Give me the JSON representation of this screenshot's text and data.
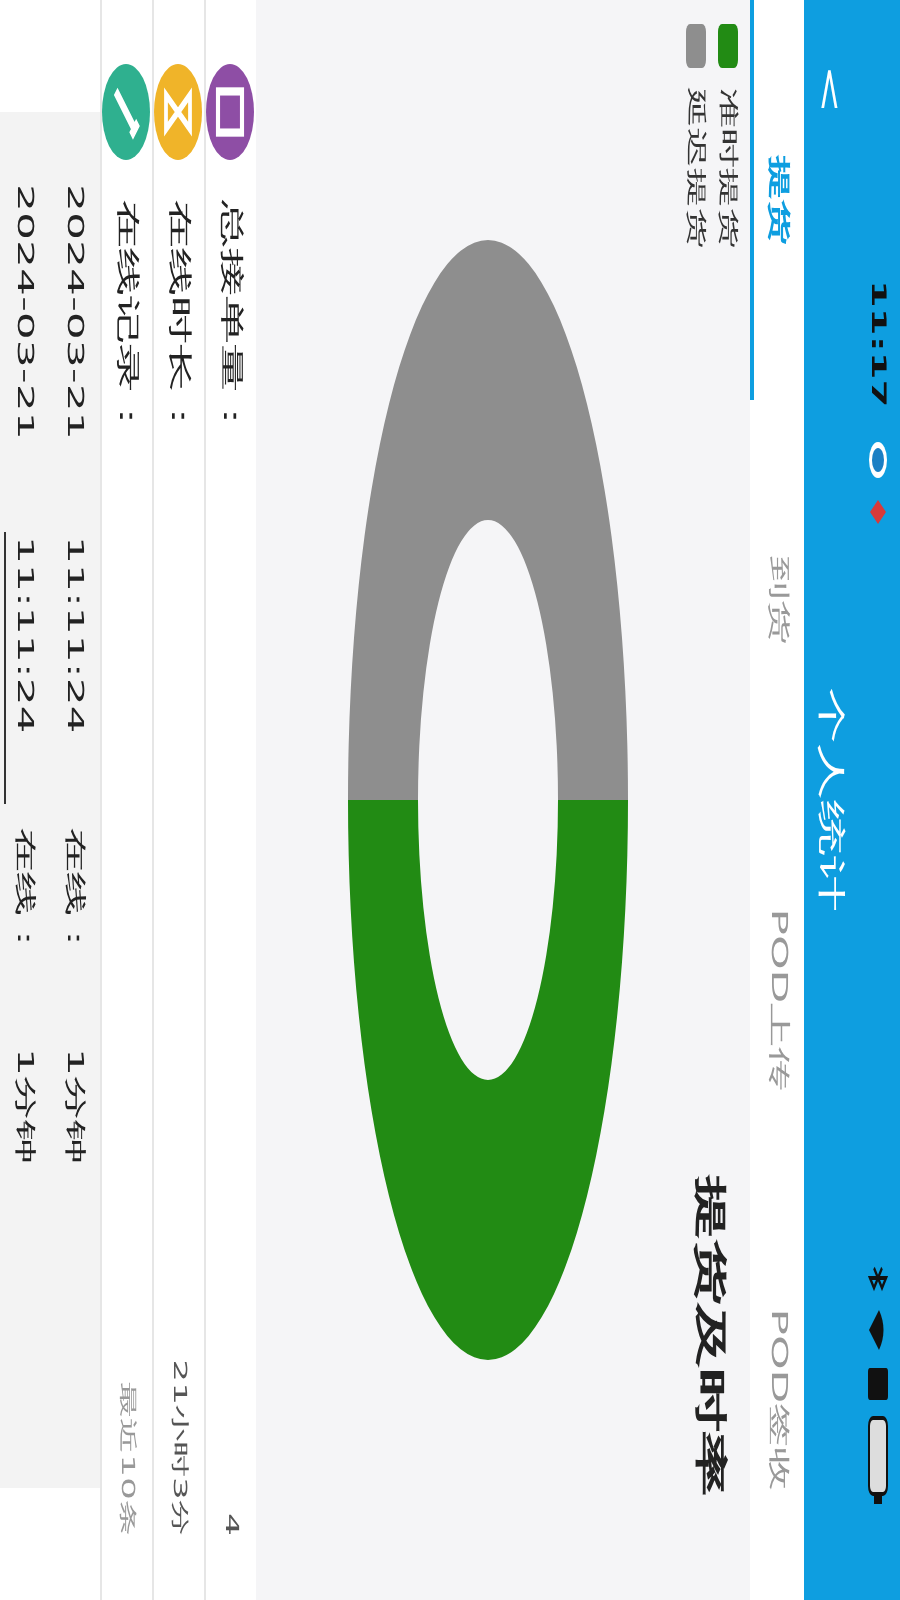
{
  "status_bar": {
    "time": "11:17"
  },
  "header": {
    "back": "<",
    "title": "个人统计"
  },
  "tabs": [
    {
      "label": "提货",
      "selected": true
    },
    {
      "label": "到货",
      "selected": false
    },
    {
      "label": "POD上传",
      "selected": false
    },
    {
      "label": "POD签收",
      "selected": false
    }
  ],
  "chart": {
    "title": "提货及时率",
    "legend": [
      {
        "label": "准时提货",
        "color": "#228b14"
      },
      {
        "label": "延迟提货",
        "color": "#8e8e8e"
      }
    ]
  },
  "stats": [
    {
      "kind": "orders",
      "label": "总接单量：",
      "value": "4"
    },
    {
      "kind": "duration",
      "label": "在线时长：",
      "value": "21小时3分"
    },
    {
      "kind": "records",
      "label": "在线记录：",
      "value": "最近10条"
    }
  ],
  "records": [
    {
      "date": "2024-03-21",
      "time": "11:11:24",
      "status": "在线：",
      "duration": "1分钟"
    },
    {
      "date": "2024-03-21",
      "time": "11:11:24",
      "status": "在线：",
      "duration": "1分钟"
    }
  ]
}
